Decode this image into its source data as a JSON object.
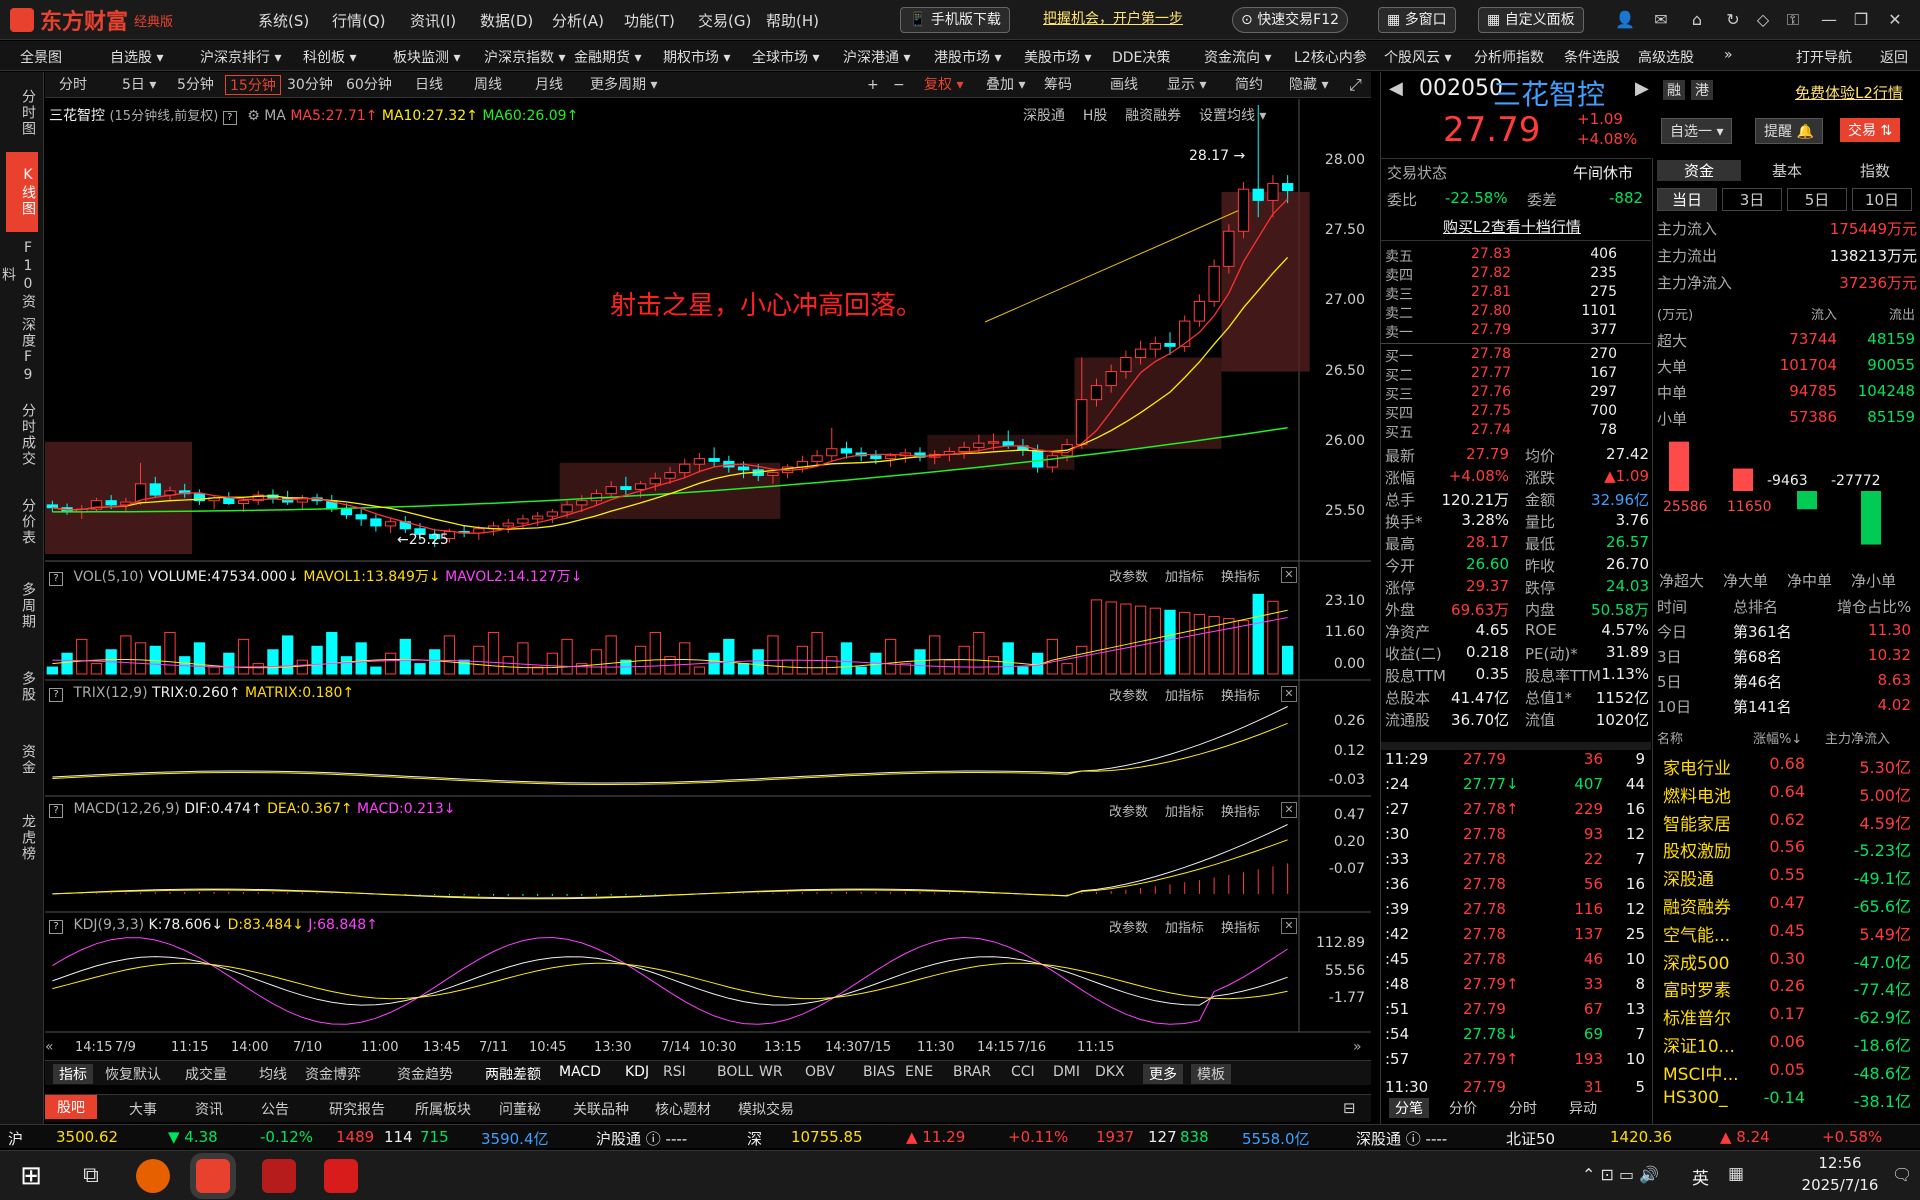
{
  "app": {
    "logo": "东方财富",
    "edition": "经典版"
  },
  "menu": [
    "系统(S)",
    "行情(Q)",
    "资讯(I)",
    "数据(D)",
    "分析(A)",
    "功能(T)",
    "交易(G)",
    "帮助(H)"
  ],
  "title_buttons": {
    "mobile": "手机版下载",
    "promo": "把握机会，开户第一步",
    "fast_trade": "快速交易F12",
    "multi_window": "多窗口",
    "custom_panel": "自定义面板"
  },
  "nav": [
    "全景图",
    "自选股 ▾",
    "沪深京排行 ▾",
    "科创板 ▾",
    "板块监测 ▾",
    "沪深京指数 ▾",
    "金融期货 ▾",
    "期权市场 ▾",
    "全球市场 ▾",
    "沪深港通 ▾",
    "港股市场 ▾",
    "美股市场 ▾",
    "DDE决策",
    "资金流向 ▾",
    "L2核心内参",
    "个股风云 ▾",
    "分析师指数",
    "条件选股",
    "高级选股",
    "»",
    "打开导航",
    "返回"
  ],
  "side": [
    "分时图",
    "K线图",
    "F10资料",
    "深度F9",
    "分时成交",
    "分价表",
    "多周期",
    "多股",
    "资金",
    "龙虎榜"
  ],
  "toolbar": [
    "分时",
    "5日 ▾",
    "5分钟",
    "15分钟",
    "30分钟",
    "60分钟",
    "日线",
    "周线",
    "月线",
    "更多周期 ▾",
    "+",
    "−",
    "复权 ▾",
    "叠加 ▾",
    "筹码",
    "画线",
    "显示 ▾",
    "简约",
    "隐藏 ▾"
  ],
  "chart_header": {
    "name": "三花智控",
    "period": "(15分钟线,前复权)",
    "ma": "MA",
    "ma5": "MA5:27.71↑",
    "ma10": "MA10:27.32↑",
    "ma60": "MA60:26.09↑",
    "links": [
      "深股通",
      "H股",
      "融资融券",
      "设置均线 ▾"
    ]
  },
  "annotation": "射击之星，小心冲高回落。",
  "labels": {
    "high": "28.17 →",
    "low": "←25.25"
  },
  "price_axis": [
    "28.00",
    "27.50",
    "27.00",
    "26.50",
    "26.00",
    "25.50"
  ],
  "vol_header": {
    "name": "VOL(5,10)",
    "vol": "VOLUME:47534.000↓",
    "m1": "MAVOL1:13.849万↓",
    "m2": "MAVOL2:14.127万↓"
  },
  "vol_axis": [
    "23.10",
    "11.60",
    "0.00"
  ],
  "trix_header": {
    "name": "TRIX(12,9)",
    "trix": "TRIX:0.260↑",
    "matrix": "MATRIX:0.180↑"
  },
  "trix_axis": [
    "0.26",
    "0.12",
    "-0.03"
  ],
  "macd_header": {
    "name": "MACD(12,26,9)",
    "dif": "DIF:0.474↑",
    "dea": "DEA:0.367↑",
    "macd": "MACD:0.213↓"
  },
  "macd_axis": [
    "0.47",
    "0.20",
    "-0.07"
  ],
  "kdj_header": {
    "name": "KDJ(9,3,3)",
    "k": "K:78.606↓",
    "d": "D:83.484↓",
    "j": "J:68.848↑"
  },
  "kdj_axis": [
    "112.89",
    "55.56",
    "-1.77"
  ],
  "panel_actions": [
    "改参数",
    "加指标",
    "换指标"
  ],
  "time_axis": [
    "14:15",
    "7/9",
    "11:15",
    "14:00",
    "7/10",
    "11:00",
    "13:45",
    "7/11",
    "10:45",
    "13:30",
    "7/14",
    "10:30",
    "13:15",
    "14:30",
    "7/15",
    "11:30",
    "14:15",
    "7/16",
    "11:15"
  ],
  "indicator_tabs": [
    "指标",
    "恢复默认",
    "成交量",
    "均线",
    "资金博弈",
    "资金趋势",
    "两融差额",
    "MACD",
    "KDJ",
    "RSI",
    "BOLL",
    "WR",
    "OBV",
    "BIAS",
    "ENE",
    "BRAR",
    "CCI",
    "DMI",
    "DKX",
    "更多",
    "模板"
  ],
  "lower_tabs": [
    "股吧",
    "大事",
    "资讯",
    "公告",
    "研究报告",
    "所属板块",
    "问董秘",
    "关联品种",
    "核心题材",
    "模拟交易"
  ],
  "stock": {
    "code": "002050",
    "name": "三花智控",
    "price": "27.79",
    "chg": "+1.09",
    "pct": "+4.08%",
    "tags": [
      "融",
      "港"
    ],
    "l2": "免费体验L2行情",
    "btn_watch": "自选一 ▾",
    "btn_alert": "提醒 🔔",
    "btn_trade": "交易 ⇅"
  },
  "trade_status": {
    "label": "交易状态",
    "value": "午间休市"
  },
  "weibi": {
    "l1": "委比",
    "v1": "-22.58%",
    "l2": "委差",
    "v2": "-882"
  },
  "buy_l2": "购买L2查看十档行情",
  "asks": [
    [
      "卖五",
      "27.83",
      "406"
    ],
    [
      "卖四",
      "27.82",
      "235"
    ],
    [
      "卖三",
      "27.81",
      "275"
    ],
    [
      "卖二",
      "27.80",
      "1101"
    ],
    [
      "卖一",
      "27.79",
      "377"
    ]
  ],
  "bids": [
    [
      "买一",
      "27.78",
      "270"
    ],
    [
      "买二",
      "27.77",
      "167"
    ],
    [
      "买三",
      "27.76",
      "297"
    ],
    [
      "买四",
      "27.75",
      "700"
    ],
    [
      "买五",
      "27.74",
      "78"
    ]
  ],
  "quote": [
    [
      "最新",
      "27.79",
      "均价",
      "27.42"
    ],
    [
      "涨幅",
      "+4.08%",
      "涨跌",
      "▲1.09"
    ],
    [
      "总手",
      "120.21万",
      "金额",
      "32.96亿"
    ],
    [
      "换手*",
      "3.28%",
      "量比",
      "3.76"
    ],
    [
      "最高",
      "28.17",
      "最低",
      "26.57"
    ],
    [
      "今开",
      "26.60",
      "昨收",
      "26.70"
    ],
    [
      "涨停",
      "29.37",
      "跌停",
      "24.03"
    ],
    [
      "外盘",
      "69.63万",
      "内盘",
      "50.58万"
    ],
    [
      "净资产",
      "4.65",
      "ROE",
      "4.57%"
    ],
    [
      "收益(二)",
      "0.218",
      "PE(动)*",
      "31.89"
    ],
    [
      "股息TTM",
      "0.35",
      "股息率TTM",
      "1.13%"
    ],
    [
      "总股本",
      "41.47亿",
      "总值1*",
      "1152亿"
    ],
    [
      "流通股",
      "36.70亿",
      "流值",
      "1020亿"
    ]
  ],
  "ticks": [
    [
      "11:29",
      "27.79",
      "36",
      "9"
    ],
    [
      ":24",
      "27.77↓",
      "407",
      "44"
    ],
    [
      ":27",
      "27.78↑",
      "229",
      "16"
    ],
    [
      ":30",
      "27.78",
      "93",
      "12"
    ],
    [
      ":33",
      "27.78",
      "22",
      "7"
    ],
    [
      ":36",
      "27.78",
      "56",
      "16"
    ],
    [
      ":39",
      "27.78",
      "116",
      "12"
    ],
    [
      ":42",
      "27.78",
      "137",
      "25"
    ],
    [
      ":45",
      "27.78",
      "46",
      "10"
    ],
    [
      ":48",
      "27.79↑",
      "33",
      "8"
    ],
    [
      ":51",
      "27.79",
      "67",
      "13"
    ],
    [
      ":54",
      "27.78↓",
      "69",
      "7"
    ],
    [
      ":57",
      "27.79↑",
      "193",
      "10"
    ],
    [
      "11:30",
      "27.79",
      "31",
      "5"
    ]
  ],
  "tick_tabs": [
    "分笔",
    "分价",
    "分时",
    "异动"
  ],
  "fund_tabs": [
    "资金",
    "基本",
    "指数"
  ],
  "fund_periods": [
    "当日",
    "3日",
    "5日",
    "10日"
  ],
  "fund_flow": [
    [
      "主力流入",
      "175449万元"
    ],
    [
      "主力流出",
      "138213万元"
    ],
    [
      "主力净流入",
      "37236万元"
    ]
  ],
  "flow_table_header": [
    "(万元)",
    "流入",
    "流出"
  ],
  "flow_table": [
    [
      "超大",
      "73744",
      "48159"
    ],
    [
      "大单",
      "101704",
      "90055"
    ],
    [
      "中单",
      "94785",
      "104248"
    ],
    [
      "小单",
      "57386",
      "85159"
    ]
  ],
  "net_bars": {
    "values": [
      25586,
      11650,
      -9463,
      -27772
    ],
    "labels": [
      "净超大",
      "净大单",
      "净中单",
      "净小单"
    ]
  },
  "rank_header": [
    "时间",
    "总排名",
    "增仓占比%"
  ],
  "rank": [
    [
      "今日",
      "第361名",
      "11.30"
    ],
    [
      "3日",
      "第68名",
      "10.32"
    ],
    [
      "5日",
      "第46名",
      "8.63"
    ],
    [
      "10日",
      "第141名",
      "4.02"
    ]
  ],
  "sector_header": [
    "名称",
    "涨幅%↓",
    "主力净流入"
  ],
  "sectors": [
    [
      "家电行业",
      "0.68",
      "5.30亿"
    ],
    [
      "燃料电池",
      "0.64",
      "5.00亿"
    ],
    [
      "智能家居",
      "0.62",
      "4.59亿"
    ],
    [
      "股权激励",
      "0.56",
      "-5.23亿"
    ],
    [
      "深股通",
      "0.55",
      "-49.1亿"
    ],
    [
      "融资融券",
      "0.47",
      "-65.6亿"
    ],
    [
      "空气能...",
      "0.45",
      "5.49亿"
    ],
    [
      "深成500",
      "0.30",
      "-47.0亿"
    ],
    [
      "富时罗素",
      "0.26",
      "-77.4亿"
    ],
    [
      "标准普尔",
      "0.17",
      "-62.9亿"
    ],
    [
      "深证10...",
      "0.06",
      "-18.6亿"
    ],
    [
      "MSCI中...",
      "0.05",
      "-48.6亿"
    ],
    [
      "HS300_",
      "-0.14",
      "-38.1亿"
    ]
  ],
  "status": {
    "sh": "沪",
    "sh_idx": "3500.62",
    "sh_chg": "▼ 4.38",
    "sh_pct": "-0.12%",
    "sh_a": "1489",
    "sh_b": "114",
    "sh_c": "715",
    "sh_amt": "3590.4亿",
    "hgt": "沪股通 ⓘ ----",
    "sz": "深",
    "sz_idx": "10755.85",
    "sz_chg": "▲ 11.29",
    "sz_pct": "+0.11%",
    "sz_a": "1937",
    "sz_b": "127",
    "sz_c": "838",
    "sz_amt": "5558.0亿",
    "sgt": "深股通 ⓘ ----",
    "bz": "北证50",
    "bz_idx": "1420.36",
    "bz_chg": "▲ 8.24",
    "bz_pct": "+0.58%"
  },
  "clock": {
    "time": "12:56",
    "date": "2025/7/16",
    "lang": "英"
  },
  "chart_data": {
    "type": "candlestick",
    "y_range": [
      25.2,
      28.3
    ],
    "candles": [
      [
        25.55,
        25.58,
        25.5,
        25.53
      ],
      [
        25.53,
        25.56,
        25.48,
        25.5
      ],
      [
        25.5,
        25.55,
        25.45,
        25.52
      ],
      [
        25.52,
        25.6,
        25.5,
        25.58
      ],
      [
        25.58,
        25.62,
        25.52,
        25.55
      ],
      [
        25.55,
        25.6,
        25.5,
        25.57
      ],
      [
        25.57,
        25.85,
        25.55,
        25.7
      ],
      [
        25.7,
        25.75,
        25.6,
        25.62
      ],
      [
        25.62,
        25.68,
        25.58,
        25.65
      ],
      [
        25.65,
        25.7,
        25.6,
        25.63
      ],
      [
        25.63,
        25.66,
        25.55,
        25.58
      ],
      [
        25.58,
        25.62,
        25.52,
        25.6
      ],
      [
        25.6,
        25.64,
        25.55,
        25.56
      ],
      [
        25.56,
        25.6,
        25.5,
        25.58
      ],
      [
        25.58,
        25.65,
        25.55,
        25.62
      ],
      [
        25.62,
        25.66,
        25.56,
        25.6
      ],
      [
        25.6,
        25.65,
        25.55,
        25.57
      ],
      [
        25.57,
        25.62,
        25.52,
        25.6
      ],
      [
        25.6,
        25.63,
        25.55,
        25.58
      ],
      [
        25.58,
        25.62,
        25.5,
        25.52
      ],
      [
        25.52,
        25.56,
        25.45,
        25.48
      ],
      [
        25.48,
        25.52,
        25.4,
        25.45
      ],
      [
        25.45,
        25.48,
        25.36,
        25.4
      ],
      [
        25.4,
        25.46,
        25.35,
        25.43
      ],
      [
        25.43,
        25.47,
        25.35,
        25.38
      ],
      [
        25.38,
        25.42,
        25.3,
        25.34
      ],
      [
        25.34,
        25.38,
        25.25,
        25.31
      ],
      [
        25.31,
        25.38,
        25.28,
        25.36
      ],
      [
        25.36,
        25.4,
        25.32,
        25.35
      ],
      [
        25.35,
        25.4,
        25.3,
        25.38
      ],
      [
        25.38,
        25.43,
        25.33,
        25.4
      ],
      [
        25.4,
        25.45,
        25.35,
        25.42
      ],
      [
        25.42,
        25.48,
        25.38,
        25.45
      ],
      [
        25.45,
        25.5,
        25.4,
        25.47
      ],
      [
        25.47,
        25.52,
        25.42,
        25.5
      ],
      [
        25.5,
        25.58,
        25.46,
        25.55
      ],
      [
        25.55,
        25.62,
        25.5,
        25.58
      ],
      [
        25.58,
        25.66,
        25.55,
        25.63
      ],
      [
        25.63,
        25.72,
        25.6,
        25.68
      ],
      [
        25.68,
        25.75,
        25.62,
        25.66
      ],
      [
        25.66,
        25.72,
        25.6,
        25.7
      ],
      [
        25.7,
        25.78,
        25.65,
        25.74
      ],
      [
        25.74,
        25.82,
        25.7,
        25.78
      ],
      [
        25.78,
        25.88,
        25.74,
        25.84
      ],
      [
        25.84,
        25.92,
        25.78,
        25.88
      ],
      [
        25.88,
        25.96,
        25.82,
        25.86
      ],
      [
        25.86,
        25.9,
        25.78,
        25.82
      ],
      [
        25.82,
        25.86,
        25.74,
        25.8
      ],
      [
        25.8,
        25.84,
        25.72,
        25.76
      ],
      [
        25.76,
        25.8,
        25.7,
        25.78
      ],
      [
        25.78,
        25.84,
        25.74,
        25.82
      ],
      [
        25.82,
        25.9,
        25.78,
        25.86
      ],
      [
        25.86,
        25.94,
        25.82,
        25.9
      ],
      [
        25.9,
        26.1,
        25.86,
        25.95
      ],
      [
        25.95,
        26.0,
        25.88,
        25.92
      ],
      [
        25.92,
        25.96,
        25.86,
        25.9
      ],
      [
        25.9,
        25.94,
        25.84,
        25.88
      ],
      [
        25.88,
        25.92,
        25.82,
        25.9
      ],
      [
        25.9,
        25.95,
        25.85,
        25.92
      ],
      [
        25.92,
        25.96,
        25.86,
        25.89
      ],
      [
        25.89,
        25.94,
        25.84,
        25.91
      ],
      [
        25.91,
        25.96,
        25.86,
        25.93
      ],
      [
        25.93,
        26.0,
        25.88,
        25.96
      ],
      [
        25.96,
        26.05,
        25.92,
        25.99
      ],
      [
        25.99,
        26.06,
        25.94,
        26.0
      ],
      [
        26.0,
        26.08,
        25.95,
        25.97
      ],
      [
        25.97,
        26.02,
        25.9,
        25.94
      ],
      [
        25.94,
        25.98,
        25.78,
        25.82
      ],
      [
        25.82,
        25.92,
        25.78,
        25.9
      ],
      [
        25.9,
        26.02,
        25.86,
        25.98
      ],
      [
        25.98,
        26.6,
        25.95,
        26.3
      ],
      [
        26.3,
        26.45,
        26.25,
        26.4
      ],
      [
        26.4,
        26.55,
        26.35,
        26.5
      ],
      [
        26.5,
        26.65,
        26.45,
        26.6
      ],
      [
        26.6,
        26.72,
        26.55,
        26.66
      ],
      [
        26.66,
        26.75,
        26.6,
        26.7
      ],
      [
        26.7,
        26.78,
        26.62,
        26.68
      ],
      [
        26.68,
        26.9,
        26.64,
        26.86
      ],
      [
        26.86,
        27.05,
        26.82,
        27.0
      ],
      [
        27.0,
        27.3,
        26.96,
        27.25
      ],
      [
        27.25,
        27.55,
        27.2,
        27.5
      ],
      [
        27.5,
        27.85,
        27.45,
        27.8
      ],
      [
        27.8,
        28.17,
        27.6,
        27.72
      ],
      [
        27.72,
        27.9,
        27.6,
        27.84
      ],
      [
        27.84,
        27.9,
        27.7,
        27.79
      ]
    ],
    "ma5_last": 27.71,
    "ma10_last": 27.32,
    "ma60_last": 26.09,
    "volume_axis": [
      0,
      23.1
    ],
    "kdj": {
      "k": 78.606,
      "d": 83.484,
      "j": 68.848
    },
    "macd": {
      "dif": 0.474,
      "dea": 0.367,
      "macd": 0.213
    },
    "trix": {
      "trix": 0.26,
      "matrix": 0.18
    }
  }
}
